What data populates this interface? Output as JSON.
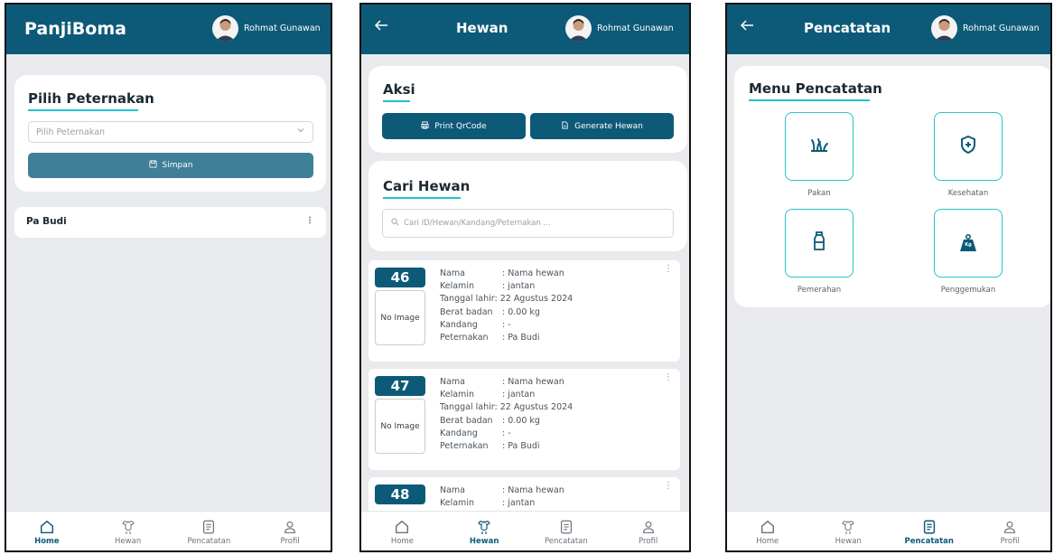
{
  "colors": {
    "primary": "#0d5a78",
    "accent": "#22c3c9",
    "background": "#e9eaed"
  },
  "user": {
    "name": "Rohmat Gunawan"
  },
  "nav": {
    "items": [
      {
        "label": "Home",
        "icon": "home-icon"
      },
      {
        "label": "Hewan",
        "icon": "animal-icon"
      },
      {
        "label": "Pencatatan",
        "icon": "notes-icon"
      },
      {
        "label": "Profil",
        "icon": "profile-icon"
      }
    ]
  },
  "home": {
    "brand": "PanjiBoma",
    "section_title": "Pilih Peternakan",
    "select_placeholder": "Pilih Peternakan",
    "save_label": "Simpan",
    "farms": [
      {
        "name": "Pa Budi"
      }
    ]
  },
  "hewan": {
    "title": "Hewan",
    "actions_title": "Aksi",
    "print_label": "Print QrCode",
    "generate_label": "Generate Hewan",
    "search_title": "Cari Hewan",
    "search_placeholder": "Cari ID/Hewan/Kandang/Peternakan ...",
    "field_labels": {
      "nama": "Nama",
      "kelamin": "Kelamin",
      "tanggal": "Tanggal lahir",
      "berat": "Berat badan",
      "kandang": "Kandang",
      "peternakan": "Peternakan"
    },
    "no_image": "No Image",
    "animals": [
      {
        "id": "46",
        "nama": ": Nama hewan",
        "kelamin": ": jantan",
        "tanggal": ": 22 Agustus 2024",
        "berat": ": 0.00 kg",
        "kandang": ": -",
        "peternakan": ": Pa Budi"
      },
      {
        "id": "47",
        "nama": ": Nama hewan",
        "kelamin": ": jantan",
        "tanggal": ": 22 Agustus 2024",
        "berat": ": 0.00 kg",
        "kandang": ": -",
        "peternakan": ": Pa Budi"
      },
      {
        "id": "48",
        "nama": ": Nama hewan",
        "kelamin": ": jantan"
      }
    ]
  },
  "pencatatan": {
    "title": "Pencatatan",
    "menu_title": "Menu Pencatatan",
    "menu": [
      {
        "label": "Pakan",
        "icon": "grass-icon"
      },
      {
        "label": "Kesehatan",
        "icon": "shield-plus-icon"
      },
      {
        "label": "Pemerahan",
        "icon": "milk-bottle-icon"
      },
      {
        "label": "Penggemukan",
        "icon": "weight-icon",
        "icon_text": "Kg"
      }
    ]
  }
}
